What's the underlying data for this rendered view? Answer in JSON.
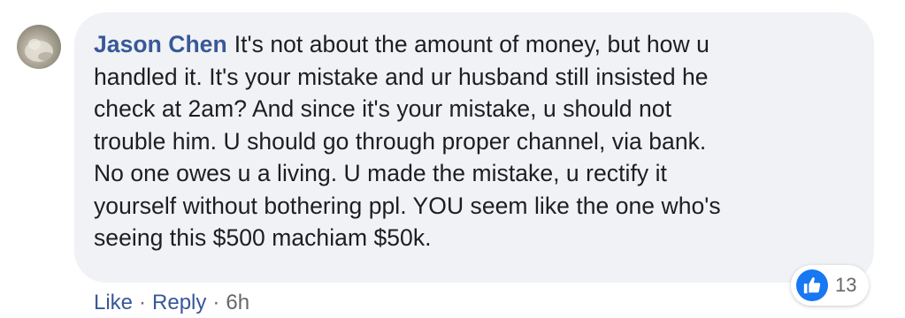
{
  "comment": {
    "author": "Jason Chen",
    "text_lines": [
      "It's not about the amount of money, but how u",
      "handled it. It's your mistake and ur husband still insisted he",
      "check at 2am? And since it's your mistake, u should not",
      "trouble him. U should go through proper channel, via bank.",
      "No one owes u a living. U made the mistake, u rectify it",
      "yourself without bothering ppl. YOU seem like the one who's",
      "seeing this $500 machiam $50k."
    ],
    "reactions": {
      "icon": "thumbs-up-icon",
      "color": "#1877f2",
      "count": "13"
    },
    "actions": {
      "like": "Like",
      "reply": "Reply",
      "separator": "·",
      "time": "6h"
    }
  }
}
